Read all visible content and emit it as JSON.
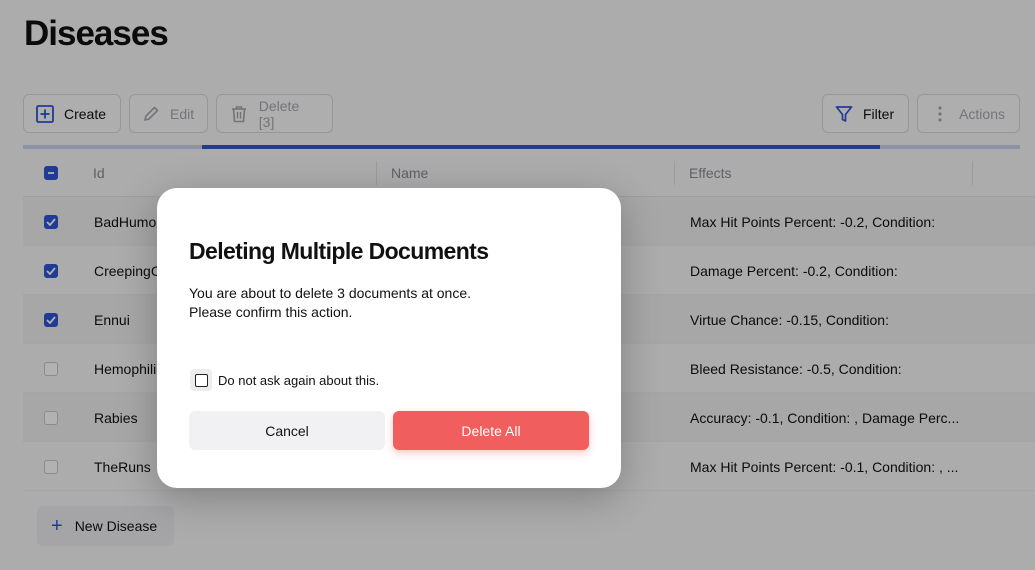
{
  "page": {
    "title": "Diseases"
  },
  "toolbar": {
    "create_label": "Create",
    "edit_label": "Edit",
    "delete_label": "Delete [3]",
    "filter_label": "Filter",
    "actions_label": "Actions"
  },
  "progress": {
    "value": 0.68
  },
  "table": {
    "columns": [
      "Id",
      "Name",
      "Effects"
    ],
    "rows": [
      {
        "id": "BadHumo",
        "name": "",
        "effects": "Max Hit Points Percent: -0.2, Condition:",
        "checked": true
      },
      {
        "id": "CreepingC",
        "name": "",
        "effects": "Damage Percent: -0.2, Condition:",
        "checked": true
      },
      {
        "id": "Ennui",
        "name": "",
        "effects": "Virtue Chance: -0.15, Condition:",
        "checked": true
      },
      {
        "id": "Hemophili",
        "name": "",
        "effects": "Bleed Resistance: -0.5, Condition:",
        "checked": false
      },
      {
        "id": "Rabies",
        "name": "",
        "effects": "Accuracy: -0.1, Condition: , Damage Perc...",
        "checked": false
      },
      {
        "id": "TheRuns",
        "name": "",
        "effects": "Max Hit Points Percent: -0.1, Condition: , ...",
        "checked": false
      }
    ]
  },
  "new_button": {
    "label": "New Disease"
  },
  "dialog": {
    "title": "Deleting Multiple Documents",
    "message_line1": "You are about to delete 3 documents at once.",
    "message_line2": "Please confirm this action.",
    "checkbox_label": "Do not ask again about this.",
    "cancel_label": "Cancel",
    "confirm_label": "Delete All"
  },
  "colors": {
    "accent": "#2f55d4",
    "danger": "#f05e5e"
  },
  "icons": [
    "plus-square-icon",
    "pencil-icon",
    "trash-icon",
    "funnel-icon",
    "vertical-dots-icon",
    "plus-icon"
  ]
}
